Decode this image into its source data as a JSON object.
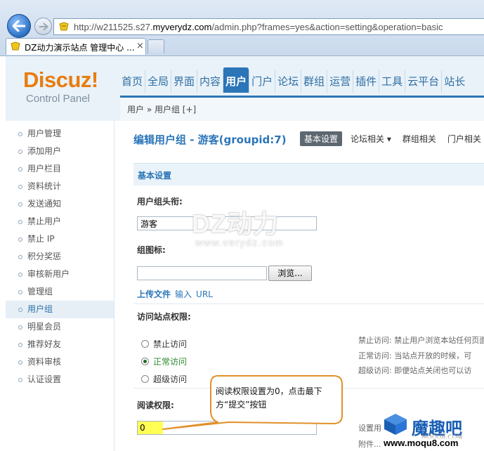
{
  "browser": {
    "url_prefix": "http://w211525.s27.",
    "url_domain": "myverydz.com",
    "url_suffix": "/admin.php?frames=yes&action=setting&operation=basic",
    "tab_title": "DZ动力演示站点 管理中心 ...",
    "tab_close": "×"
  },
  "header": {
    "logo": "Discuz!",
    "logo_sub": "Control Panel",
    "nav": [
      "首页",
      "全局",
      "界面",
      "内容",
      "用户",
      "门户",
      "论坛",
      "群组",
      "运营",
      "插件",
      "工具",
      "云平台",
      "站长"
    ],
    "active_nav": "用户",
    "breadcrumb": "用户 » 用户组 [+]"
  },
  "sidebar": {
    "items": [
      {
        "label": "用户管理"
      },
      {
        "label": "添加用户"
      },
      {
        "label": "用户栏目"
      },
      {
        "label": "资料统计"
      },
      {
        "label": "发送通知"
      },
      {
        "label": "禁止用户"
      },
      {
        "label": "禁止 IP"
      },
      {
        "label": "积分奖惩"
      },
      {
        "label": "审核新用户"
      },
      {
        "label": "管理组"
      },
      {
        "label": "用户组",
        "active": true
      },
      {
        "label": "明星会员"
      },
      {
        "label": "推荐好友"
      },
      {
        "label": "资料审核"
      },
      {
        "label": "认证设置"
      }
    ]
  },
  "content": {
    "title": "编辑用户组 - 游客(groupid:7)",
    "tabs": [
      "基本设置",
      "论坛相关 ▾",
      "群组相关",
      "门户相关"
    ],
    "section": "基本设置",
    "field_title_label": "用户组头衔:",
    "field_title_value": "游客",
    "field_icon_label": "组图标:",
    "browse_button": "浏览...",
    "upload_file": "上传文件",
    "upload_input": "输入",
    "upload_url": "URL",
    "access_label": "访问站点权限:",
    "radio_options": [
      {
        "label": "禁止访问",
        "checked": false
      },
      {
        "label": "正常访问",
        "checked": true
      },
      {
        "label": "超级访问",
        "checked": false
      }
    ],
    "hints": [
      "禁止访问: 禁止用户浏览本站任何页面",
      "正常访问: 当站点开放的时候，可",
      "超级访问: 即便站点关闭也可以访"
    ],
    "read_label": "阅读权限:",
    "read_value": "0",
    "read_hints": [
      "设置用",
      "附件..."
    ]
  },
  "callout": {
    "text": "阅读权限设置为0，点击最下方“提交”按钮"
  },
  "watermark": {
    "main": "DZ动力",
    "sub": "www.verydz.com",
    "brand": "魔趣吧",
    "brand_small": "MOQU8.COM",
    "brand_url": "www.moqu8.com"
  },
  "colors": {
    "accent": "#2b75b8",
    "logo": "#e87c10",
    "highlight": "#ffff55",
    "callout_border": "#e0902a"
  }
}
